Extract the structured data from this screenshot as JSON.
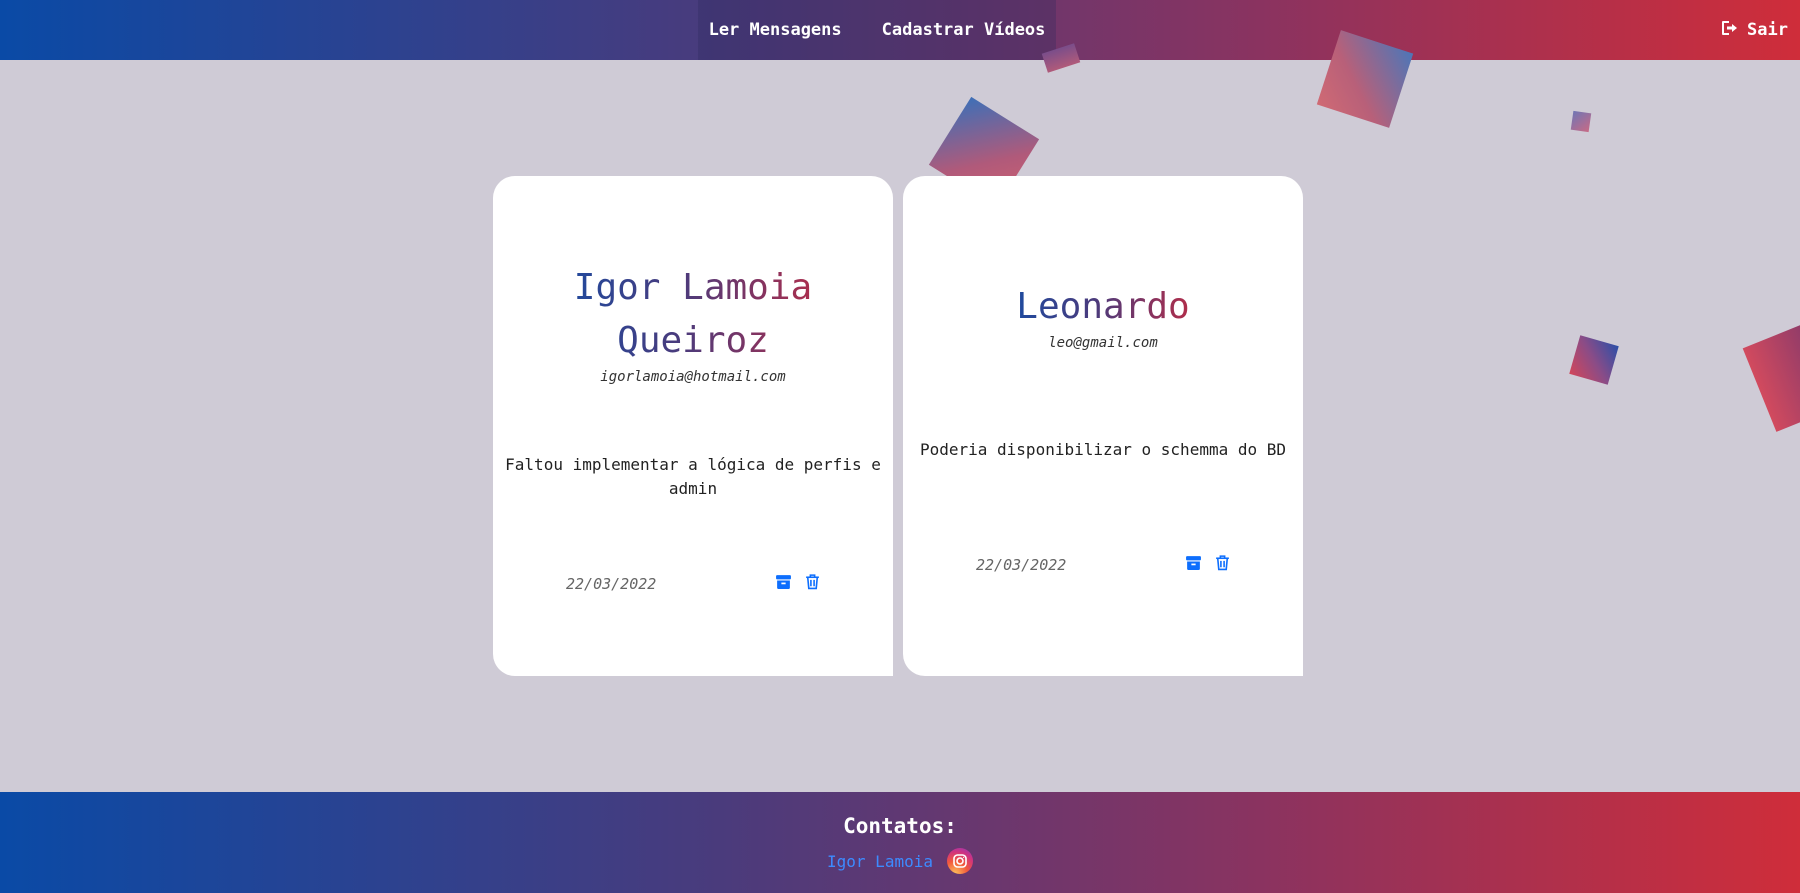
{
  "header": {
    "nav": [
      {
        "label": "Ler Mensagens"
      },
      {
        "label": "Cadastrar Vídeos"
      }
    ],
    "logout_label": "Sair",
    "logout_icon": "sign-out-icon"
  },
  "messages": [
    {
      "name": "Igor Lamoia Queiroz",
      "email": "igorlamoia@hotmail.com",
      "text": "Faltou implementar a lógica de perfis e admin",
      "date": "22/03/2022",
      "archive_icon": "archive-icon",
      "delete_icon": "trash-icon"
    },
    {
      "name": "Leonardo",
      "email": "leo@gmail.com",
      "text": "Poderia disponibilizar o schemma do BD",
      "date": "22/03/2022",
      "archive_icon": "archive-icon",
      "delete_icon": "trash-icon"
    }
  ],
  "footer": {
    "title": "Contatos:",
    "contact_name": "Igor Lamoia",
    "contact_icon": "instagram-icon"
  },
  "colors": {
    "gradient_start": "#0a4aa6",
    "gradient_end": "#cf2d3a",
    "background": "#cfcbd6",
    "icon_blue": "#0d6efd",
    "link_blue": "#3d8bff"
  }
}
